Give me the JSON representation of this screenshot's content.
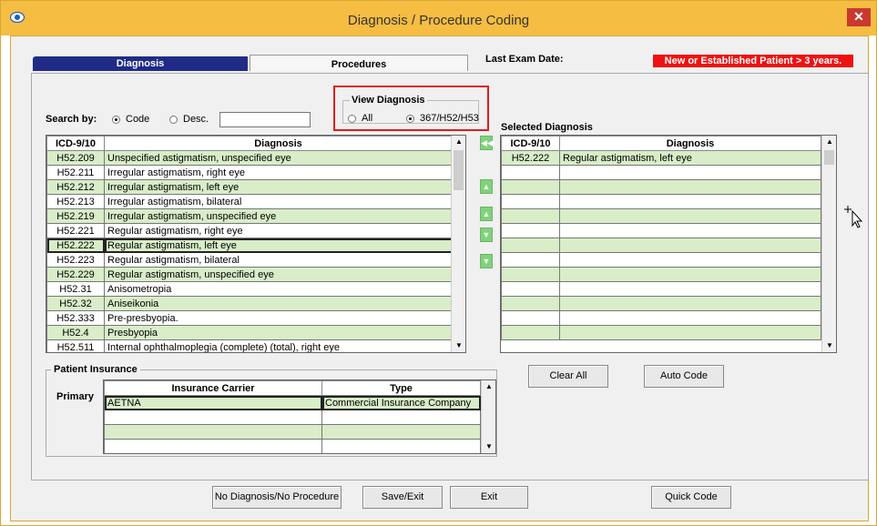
{
  "window": {
    "title": "Diagnosis / Procedure Coding",
    "close_label": "✕"
  },
  "tabs": {
    "diagnosis": "Diagnosis",
    "procedures": "Procedures"
  },
  "last_exam_label": "Last Exam Date:",
  "patient_status": "New or Established Patient > 3 years.",
  "search": {
    "label": "Search by:",
    "code_label": "Code",
    "desc_label": "Desc.",
    "value": "",
    "selected": "Code"
  },
  "view": {
    "title": "View Diagnosis",
    "all_label": "All",
    "filter_label": "367/H52/H53",
    "selected": "367/H52/H53"
  },
  "diagnosis_list": {
    "headers": [
      "ICD-9/10",
      "Diagnosis"
    ],
    "rows": [
      [
        "H52.209",
        "Unspecified astigmatism, unspecified eye"
      ],
      [
        "H52.211",
        "Irregular astigmatism, right eye"
      ],
      [
        "H52.212",
        "Irregular astigmatism, left eye"
      ],
      [
        "H52.213",
        "Irregular astigmatism, bilateral"
      ],
      [
        "H52.219",
        "Irregular astigmatism, unspecified eye"
      ],
      [
        "H52.221",
        "Regular astigmatism, right eye"
      ],
      [
        "H52.222",
        "Regular astigmatism, left eye"
      ],
      [
        "H52.223",
        "Regular astigmatism, bilateral"
      ],
      [
        "H52.229",
        "Regular astigmatism, unspecified eye"
      ],
      [
        "H52.31",
        "Anisometropia"
      ],
      [
        "H52.32",
        "Aniseikonia"
      ],
      [
        "H52.333",
        "Pre-presbyopia."
      ],
      [
        "H52.4",
        "Presbyopia"
      ],
      [
        "H52.511",
        "Internal ophthalmoplegia (complete) (total), right eye"
      ]
    ],
    "selected_index": 6
  },
  "selected_diagnosis": {
    "title": "Selected Diagnosis",
    "headers": [
      "ICD-9/10",
      "Diagnosis"
    ],
    "rows": [
      [
        "H52.222",
        "Regular astigmatism, left eye"
      ],
      [
        "",
        ""
      ],
      [
        "",
        ""
      ],
      [
        "",
        ""
      ],
      [
        "",
        ""
      ],
      [
        "",
        ""
      ],
      [
        "",
        ""
      ],
      [
        "",
        ""
      ],
      [
        "",
        ""
      ],
      [
        "",
        ""
      ],
      [
        "",
        ""
      ],
      [
        "",
        ""
      ],
      [
        "",
        ""
      ]
    ]
  },
  "insurance": {
    "title": "Patient Insurance",
    "primary_label": "Primary",
    "headers": [
      "Insurance Carrier",
      "Type"
    ],
    "rows": [
      [
        "AETNA",
        "Commercial Insurance Company"
      ],
      [
        "",
        ""
      ],
      [
        "",
        ""
      ],
      [
        "",
        ""
      ]
    ]
  },
  "buttons": {
    "clear_all": "Clear All",
    "auto_code": "Auto Code",
    "no_diagnosis": "No Diagnosis/No Procedure",
    "save_exit": "Save/Exit",
    "exit": "Exit",
    "quick_code": "Quick Code"
  },
  "colors": {
    "title_bar": "#f5bd42",
    "tab_active": "#1f2b87",
    "status_red": "#ee1111",
    "row_alt": "#d8edc8",
    "highlight_red": "#e01c1c"
  }
}
